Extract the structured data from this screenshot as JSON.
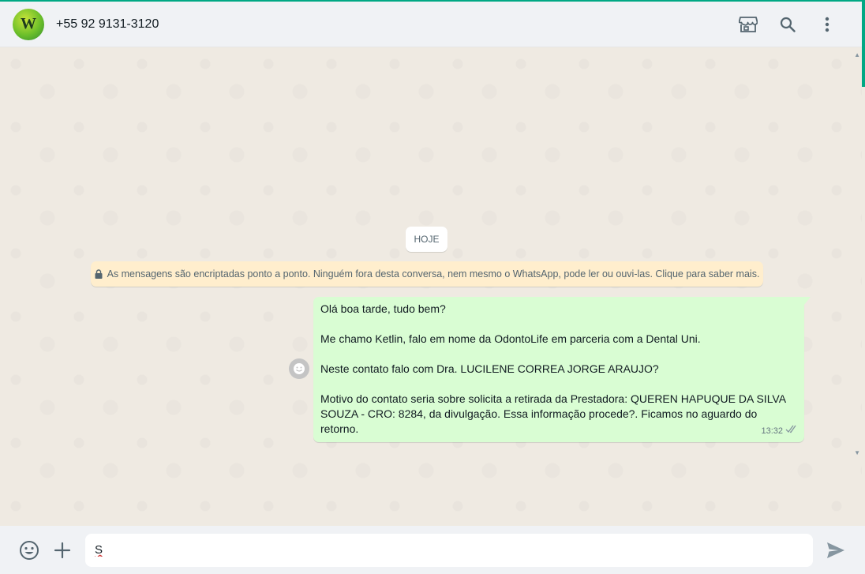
{
  "header": {
    "contact_name": "+55 92 9131-3120",
    "avatar_initial": "W",
    "icons": [
      "catalog-store-icon",
      "search-icon",
      "menu-dots-icon"
    ]
  },
  "chat": {
    "date_chip": "HOJE",
    "encryption_notice": "As mensagens são encriptadas ponto a ponto. Ninguém fora desta conversa, nem mesmo o WhatsApp, pode ler ou ouvi-las. Clique para saber mais.",
    "messages": [
      {
        "direction": "outgoing",
        "lines": [
          "Olá boa tarde, tudo bem?",
          "Me chamo Ketlin, falo em nome da OdontoLife em parceria com a Dental Uni.",
          "Neste contato falo com Dra. LUCILENE CORREA JORGE ARAUJO?",
          "Motivo do contato seria sobre solicita a retirada da Prestadora: QUEREN HAPUQUE DA SILVA SOUZA - CRO: 8284, da divulgação. Essa informação procede?. Ficamos no aguardo do retorno."
        ],
        "time": "13:32",
        "status": "delivered"
      }
    ]
  },
  "composer": {
    "input_value": "S",
    "icons": [
      "emoji-icon",
      "plus-icon",
      "send-icon"
    ]
  },
  "colors": {
    "accent": "#00a884",
    "outgoing_bubble": "#d9fdd3",
    "notice_bg": "#ffeecd",
    "chat_bg": "#efeae2"
  }
}
